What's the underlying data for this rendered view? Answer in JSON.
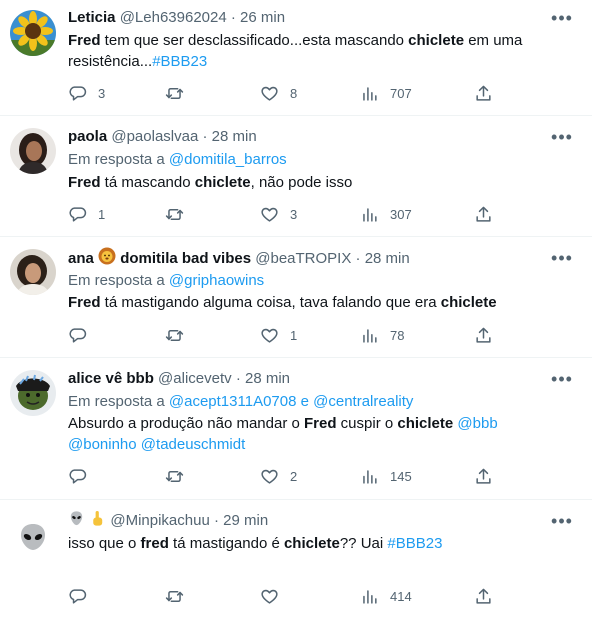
{
  "tweets": [
    {
      "name": "Leticia",
      "handle": "@Leh63962024",
      "dot": "·",
      "time": "26 min",
      "text_parts": [
        {
          "t": "Fred",
          "s": "b"
        },
        {
          "t": " tem que ser desclassificado...esta mascando ",
          "s": ""
        },
        {
          "t": "chiclete",
          "s": "b"
        },
        {
          "t": " em uma resistência...",
          "s": ""
        },
        {
          "t": "#BBB23",
          "s": "link"
        }
      ],
      "counts": {
        "reply": "3",
        "retweet": "",
        "like": "8",
        "views": "707"
      }
    },
    {
      "name": "paola",
      "handle": "@paolaslvaa",
      "dot": "·",
      "time": "28 min",
      "reply_prefix": "Em resposta a ",
      "reply_to": "@domitila_barros",
      "text_parts": [
        {
          "t": "Fred",
          "s": "b"
        },
        {
          "t": " tá mascando ",
          "s": ""
        },
        {
          "t": "chiclete",
          "s": "b"
        },
        {
          "t": ", não pode isso",
          "s": ""
        }
      ],
      "counts": {
        "reply": "1",
        "retweet": "",
        "like": "3",
        "views": "307"
      }
    },
    {
      "name": "ana",
      "name_emoji": "lion-face-emoji",
      "name_suffix": "domitila bad vibes",
      "handle": "@beaTROPIX",
      "dot": "·",
      "time": "28 min",
      "reply_prefix": "Em resposta a ",
      "reply_to": "@griphaowins",
      "text_parts": [
        {
          "t": "Fred",
          "s": "b"
        },
        {
          "t": " tá mastigando alguma coisa, tava falando que era ",
          "s": ""
        },
        {
          "t": "chiclete",
          "s": "b"
        }
      ],
      "counts": {
        "reply": "",
        "retweet": "",
        "like": "1",
        "views": "78"
      }
    },
    {
      "name": "alice vê bbb",
      "handle": "@alicevetv",
      "dot": "·",
      "time": "28 min",
      "reply_prefix": "Em resposta a ",
      "reply_to": "@acept1311A0708",
      "reply_joiner": " e ",
      "reply_to_2": "@centralreality",
      "text_parts": [
        {
          "t": "Absurdo a produção não mandar o ",
          "s": ""
        },
        {
          "t": "Fred",
          "s": "b"
        },
        {
          "t": " cuspir o ",
          "s": ""
        },
        {
          "t": "chiclete",
          "s": "b"
        },
        {
          "t": " ",
          "s": ""
        },
        {
          "t": "@bbb",
          "s": "link"
        },
        {
          "t": " ",
          "s": ""
        },
        {
          "t": "@boninho",
          "s": "link"
        },
        {
          "t": " ",
          "s": ""
        },
        {
          "t": "@tadeuschmidt",
          "s": "link"
        }
      ],
      "counts": {
        "reply": "",
        "retweet": "",
        "like": "2",
        "views": "145"
      }
    },
    {
      "name_emojis": [
        "alien-emoji",
        "pointing-up-hand-emoji"
      ],
      "handle": "@Minpikachuu",
      "dot": "·",
      "time": "29 min",
      "text_parts": [
        {
          "t": "isso que o ",
          "s": ""
        },
        {
          "t": "fred",
          "s": "b"
        },
        {
          "t": " tá mastigando é ",
          "s": ""
        },
        {
          "t": "chiclete",
          "s": "b"
        },
        {
          "t": "?? Uai ",
          "s": ""
        },
        {
          "t": "#BBB23",
          "s": "link"
        }
      ],
      "counts": {
        "reply": "",
        "retweet": "",
        "like": "",
        "views": "414"
      }
    }
  ],
  "colors": {
    "link": "#1d9bf0",
    "secondary": "#536471",
    "text": "#0f1419",
    "divider": "#eff3f4"
  }
}
